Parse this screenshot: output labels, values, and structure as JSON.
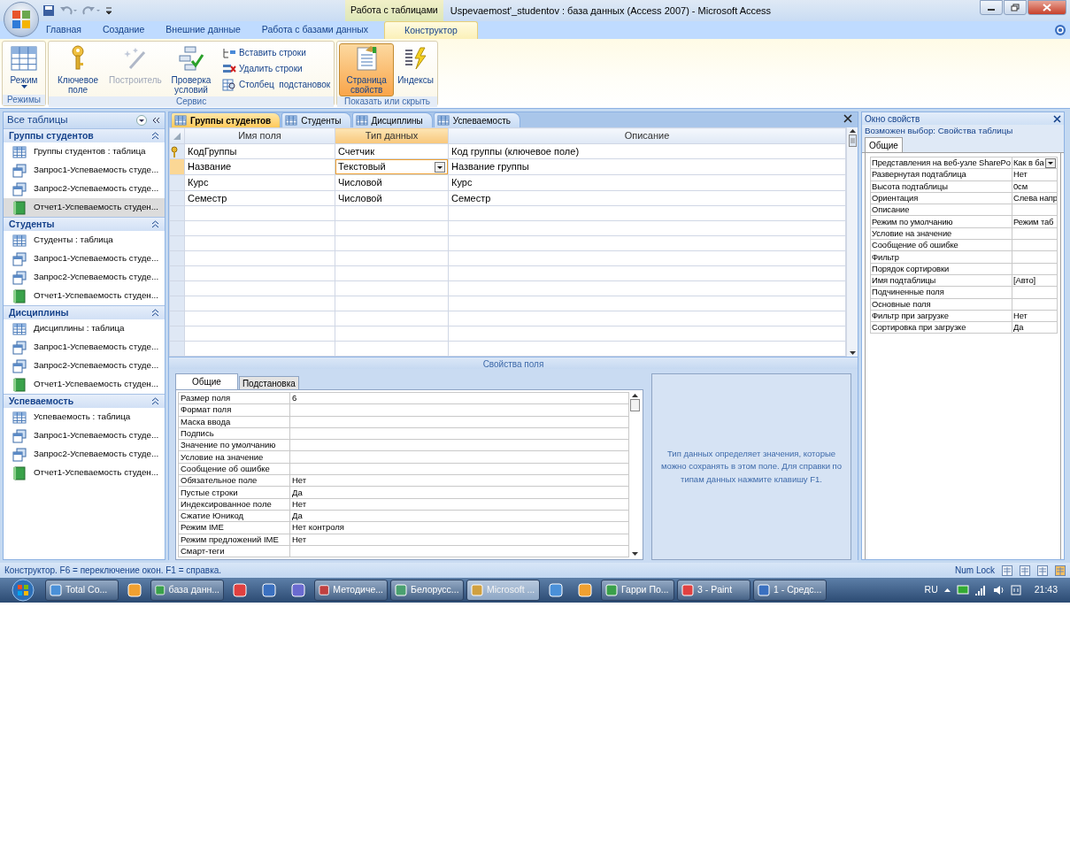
{
  "window": {
    "context_tab": "Работа с таблицами",
    "title": "Uspevaemost'_studentov : база данных (Access 2007)  -  Microsoft Access"
  },
  "ribbon_tabs": [
    {
      "label": "Главная",
      "selected": false
    },
    {
      "label": "Создание",
      "selected": false
    },
    {
      "label": "Внешние данные",
      "selected": false
    },
    {
      "label": "Работа с базами данных",
      "selected": false
    },
    {
      "label": "Конструктор",
      "selected": true
    }
  ],
  "ribbon_groups": [
    {
      "label": "Режимы",
      "buttons": [
        {
          "label": "Режим",
          "kind": "large",
          "disabled": false,
          "pressed": false
        }
      ]
    },
    {
      "label": "Сервис",
      "buttons": [
        {
          "label": "Ключевое поле",
          "kind": "large",
          "disabled": false,
          "pressed": false
        },
        {
          "label": "Построитель",
          "kind": "large",
          "disabled": true,
          "pressed": false
        },
        {
          "label": "Проверка условий",
          "kind": "large",
          "disabled": false,
          "pressed": false
        },
        {
          "label": "Вставить строки",
          "kind": "small",
          "disabled": false,
          "pressed": false
        },
        {
          "label": "Удалить строки",
          "kind": "small",
          "disabled": false,
          "pressed": false
        },
        {
          "label": "Столбец  подстановок",
          "kind": "small",
          "disabled": false,
          "pressed": false
        }
      ]
    },
    {
      "label": "Показать или скрыть",
      "buttons": [
        {
          "label": "Страница свойств",
          "kind": "large",
          "disabled": false,
          "pressed": true
        },
        {
          "label": "Индексы",
          "kind": "large",
          "disabled": false,
          "pressed": false
        }
      ]
    }
  ],
  "nav_pane": {
    "title": "Все таблицы",
    "groups": [
      {
        "title": "Группы студентов",
        "items": [
          {
            "label": "Группы студентов : таблица",
            "kind": "table",
            "selected": false
          },
          {
            "label": "Запрос1-Успеваемость студе...",
            "kind": "query",
            "selected": false
          },
          {
            "label": "Запрос2-Успеваемость студе...",
            "kind": "query",
            "selected": false
          },
          {
            "label": "Отчет1-Успеваемость студен...",
            "kind": "report",
            "selected": true
          }
        ]
      },
      {
        "title": "Студенты",
        "items": [
          {
            "label": "Студенты : таблица",
            "kind": "table",
            "selected": false
          },
          {
            "label": "Запрос1-Успеваемость студе...",
            "kind": "query",
            "selected": false
          },
          {
            "label": "Запрос2-Успеваемость студе...",
            "kind": "query",
            "selected": false
          },
          {
            "label": "Отчет1-Успеваемость студен...",
            "kind": "report",
            "selected": false
          }
        ]
      },
      {
        "title": "Дисциплины",
        "items": [
          {
            "label": "Дисциплины : таблица",
            "kind": "table",
            "selected": false
          },
          {
            "label": "Запрос1-Успеваемость студе...",
            "kind": "query",
            "selected": false
          },
          {
            "label": "Запрос2-Успеваемость студе...",
            "kind": "query",
            "selected": false
          },
          {
            "label": "Отчет1-Успеваемость студен...",
            "kind": "report",
            "selected": false
          }
        ]
      },
      {
        "title": "Успеваемость",
        "items": [
          {
            "label": "Успеваемость : таблица",
            "kind": "table",
            "selected": false
          },
          {
            "label": "Запрос1-Успеваемость студе...",
            "kind": "query",
            "selected": false
          },
          {
            "label": "Запрос2-Успеваемость студе...",
            "kind": "query",
            "selected": false
          },
          {
            "label": "Отчет1-Успеваемость студен...",
            "kind": "report",
            "selected": false
          }
        ]
      }
    ]
  },
  "doc_tabs": [
    {
      "label": "Группы студентов",
      "selected": true
    },
    {
      "label": "Студенты",
      "selected": false
    },
    {
      "label": "Дисциплины",
      "selected": false
    },
    {
      "label": "Успеваемость",
      "selected": false
    }
  ],
  "design_grid": {
    "columns": [
      {
        "label": "Имя поля",
        "selected": false
      },
      {
        "label": "Тип данных",
        "selected": true
      },
      {
        "label": "Описание",
        "selected": false
      }
    ],
    "rows": [
      {
        "field": "КодГруппы",
        "type": "Счетчик",
        "description": "Код группы (ключевое поле)",
        "primary_key": true,
        "selected": false
      },
      {
        "field": "Название",
        "type": "Текстовый",
        "description": "Название группы",
        "primary_key": false,
        "selected": true
      },
      {
        "field": "Курс",
        "type": "Числовой",
        "description": "Курс",
        "primary_key": false,
        "selected": false
      },
      {
        "field": "Семестр",
        "type": "Числовой",
        "description": "Семестр",
        "primary_key": false,
        "selected": false
      }
    ]
  },
  "field_properties": {
    "title": "Свойства поля",
    "tabs": [
      {
        "label": "Общие",
        "selected": true
      },
      {
        "label": "Подстановка",
        "selected": false
      }
    ],
    "rows": [
      {
        "name": "Размер поля",
        "value": "6"
      },
      {
        "name": "Формат поля",
        "value": ""
      },
      {
        "name": "Маска ввода",
        "value": ""
      },
      {
        "name": "Подпись",
        "value": ""
      },
      {
        "name": "Значение по умолчанию",
        "value": ""
      },
      {
        "name": "Условие на значение",
        "value": ""
      },
      {
        "name": "Сообщение об ошибке",
        "value": ""
      },
      {
        "name": "Обязательное поле",
        "value": "Нет"
      },
      {
        "name": "Пустые строки",
        "value": "Да"
      },
      {
        "name": "Индексированное поле",
        "value": "Нет"
      },
      {
        "name": "Сжатие Юникод",
        "value": "Да"
      },
      {
        "name": "Режим IME",
        "value": "Нет контроля"
      },
      {
        "name": "Режим предложений IME",
        "value": "Нет"
      },
      {
        "name": "Смарт-теги",
        "value": ""
      }
    ],
    "hint": "Тип данных определяет значения, которые можно сохранять в этом поле.  Для справки по типам данных нажмите клавишу F1."
  },
  "property_sheet": {
    "title": "Окно свойств",
    "selection": "Возможен выбор:  Свойства таблицы",
    "tabs": [
      {
        "label": "Общие",
        "selected": true
      }
    ],
    "rows": [
      {
        "name": "Представления на веб-узле SharePo",
        "value": "Как в ба",
        "kind": "dropdown"
      },
      {
        "name": "Развернутая подтаблица",
        "value": "Нет",
        "kind": "text"
      },
      {
        "name": "Высота подтаблицы",
        "value": "0см",
        "kind": "text"
      },
      {
        "name": "Ориентация",
        "value": "Слева напр",
        "kind": "text"
      },
      {
        "name": "Описание",
        "value": "",
        "kind": "text"
      },
      {
        "name": "Режим по умолчанию",
        "value": "Режим таб",
        "kind": "text"
      },
      {
        "name": "Условие на значение",
        "value": "",
        "kind": "text"
      },
      {
        "name": "Сообщение об ошибке",
        "value": "",
        "kind": "text"
      },
      {
        "name": "Фильтр",
        "value": "",
        "kind": "text"
      },
      {
        "name": "Порядок сортировки",
        "value": "",
        "kind": "text"
      },
      {
        "name": "Имя подтаблицы",
        "value": "[Авто]",
        "kind": "text"
      },
      {
        "name": "Подчиненные поля",
        "value": "",
        "kind": "text"
      },
      {
        "name": "Основные поля",
        "value": "",
        "kind": "text"
      },
      {
        "name": "Фильтр при загрузке",
        "value": "Нет",
        "kind": "text"
      },
      {
        "name": "Сортировка при загрузке",
        "value": "Да",
        "kind": "text"
      }
    ]
  },
  "status_bar": {
    "text": "Конструктор.  F6 = переключение окон.  F1 = справка.",
    "indicator": "Num Lock"
  },
  "taskbar": {
    "items": [
      {
        "kind": "button",
        "label": "Total Co...",
        "selected": false
      },
      {
        "kind": "icon",
        "selected": false
      },
      {
        "kind": "button",
        "label": "база данн...",
        "selected": false
      },
      {
        "kind": "icon",
        "selected": false
      },
      {
        "kind": "icon",
        "selected": false
      },
      {
        "kind": "icon",
        "selected": false
      },
      {
        "kind": "button",
        "label": "Методиче...",
        "selected": false
      },
      {
        "kind": "button",
        "label": "Белорусс...",
        "selected": false
      },
      {
        "kind": "button",
        "label": "Microsoft ...",
        "selected": true
      },
      {
        "kind": "icon",
        "selected": false
      },
      {
        "kind": "icon",
        "selected": false
      },
      {
        "kind": "button",
        "label": "Гарри По...",
        "selected": false
      },
      {
        "kind": "button",
        "label": "3 - Paint",
        "selected": false
      },
      {
        "kind": "button",
        "label": "1 - Средс...",
        "selected": false
      }
    ],
    "language": "RU",
    "clock": "21:43"
  }
}
